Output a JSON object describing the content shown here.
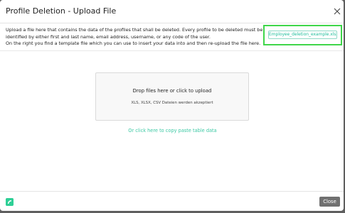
{
  "modal": {
    "title": "Profile Deletion - Upload File",
    "description_lines": [
      "Upload a file here that contains the data of the profiles that shall be deleted. Every profile to be deleted must be",
      "identified by either first and last name, email address, username, or any code of the user.",
      "On the right you find a template file which you can use to insert your data into and then re-upload the file here."
    ],
    "template_file": "Employee_deletion_example.xlsx",
    "highlight_color": "#3fd64a",
    "accent_color": "#3cc9a4"
  },
  "dropzone": {
    "title": "Drop files here or click to upload",
    "subtitle": "XLS, XLSX, CSV Dateien werden akzeptiert"
  },
  "paste_link": "Or click here to copy paste table data",
  "footer": {
    "close_label": "Close",
    "logo_icon": "brand-logo-icon"
  },
  "icons": {
    "close": "close-icon"
  }
}
